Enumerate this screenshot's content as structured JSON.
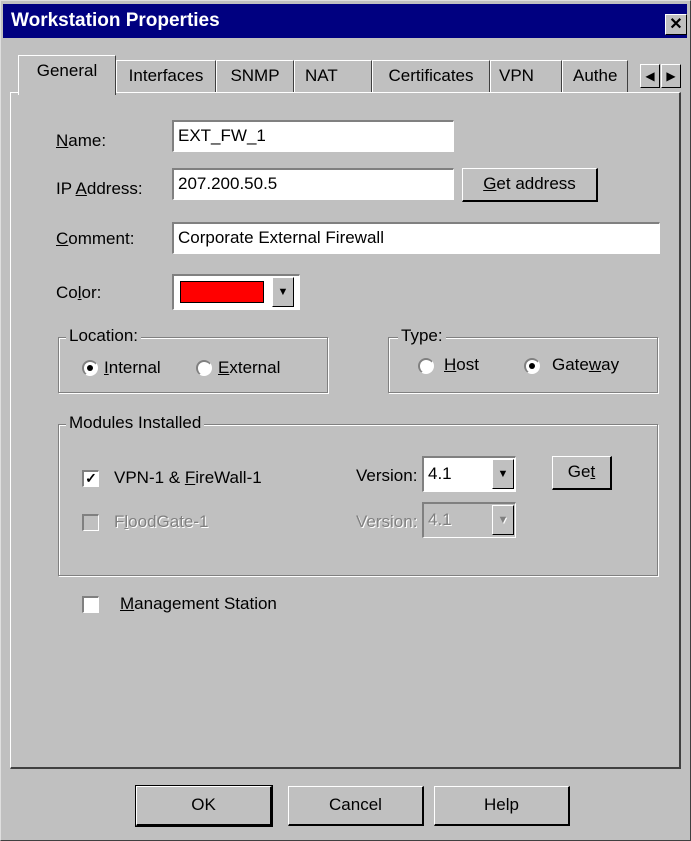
{
  "window": {
    "title": "Workstation Properties",
    "close_glyph": "✕"
  },
  "tabs": [
    {
      "label": "General",
      "active": true
    },
    {
      "label": "Interfaces"
    },
    {
      "label": "SNMP"
    },
    {
      "label": "NAT"
    },
    {
      "label": "Certificates"
    },
    {
      "label": "VPN"
    },
    {
      "label": "Authe"
    }
  ],
  "tab_scroll": {
    "left_icon": "triangle-left",
    "right_icon": "triangle-right"
  },
  "form": {
    "name": {
      "label_u": "N",
      "label_rest": "ame:",
      "value": "EXT_FW_1"
    },
    "ip": {
      "label_pre": "IP ",
      "label_u": "A",
      "label_rest": "ddress:",
      "value": "207.200.50.5",
      "button_u": "G",
      "button_rest": "et address"
    },
    "comment": {
      "label_u": "C",
      "label_rest": "omment:",
      "value": "Corporate External Firewall"
    },
    "color": {
      "label_pre": "Co",
      "label_u": "l",
      "label_rest": "or:",
      "value_hex": "#ff0000"
    }
  },
  "location": {
    "legend": "Location:",
    "options": [
      {
        "label_u": "I",
        "label_rest": "nternal",
        "selected": true
      },
      {
        "label_u": "E",
        "label_rest": "xternal",
        "selected": false
      }
    ]
  },
  "type": {
    "legend": "Type:",
    "options": [
      {
        "label_u": "H",
        "label_rest": "ost",
        "selected": false
      },
      {
        "label_pre": "Gate",
        "label_u": "w",
        "label_rest": "ay",
        "selected": true
      }
    ]
  },
  "modules": {
    "legend": "Modules Installed",
    "vpn": {
      "label_pre": "VPN-1 & ",
      "label_u": "F",
      "label_rest": "ireWall-1",
      "checked": true,
      "version_label": "Version:",
      "version": "4.1",
      "get_pre": "Ge",
      "get_u": "t"
    },
    "floodgate": {
      "label_pre": "F",
      "label_u": "l",
      "label_rest": "oodGate-1",
      "checked": false,
      "version_label": "Version:",
      "version": "4.1"
    }
  },
  "management": {
    "label_u": "M",
    "label_rest": "anagement Station",
    "checked": false
  },
  "footer": {
    "ok": "OK",
    "cancel": "Cancel",
    "help": "Help"
  },
  "colors": {
    "title_bg": "#000080",
    "face": "#c0c0c0",
    "selected_color": "#ff0000"
  }
}
